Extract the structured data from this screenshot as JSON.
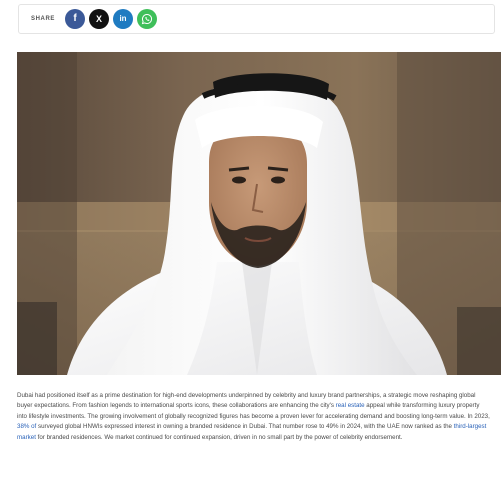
{
  "share": {
    "label": "SHARE",
    "buttons": [
      {
        "name": "facebook",
        "glyph": "f",
        "color": "#3b5998"
      },
      {
        "name": "x",
        "glyph": "X",
        "color": "#111111"
      },
      {
        "name": "linkedin",
        "glyph": "in",
        "color": "#1f7bc1"
      },
      {
        "name": "whatsapp",
        "glyph": "",
        "color": "#3fbf5a"
      }
    ]
  },
  "colors": {
    "link": "#2a62b8",
    "text": "#4a4a4a"
  },
  "article": {
    "p1": "Dubai had positioned itself as a prime destination for high-end developments underpinned by celebrity and luxury brand partnerships, a strategic move reshaping global buyer expectations. From fashion legends to international sports icons, these collaborations are enhancing the city's ",
    "link1": "real estate",
    "p2": " appeal while transforming luxury property into lifestyle investments. The growing involvement of globally recognized figures has become a proven lever for accelerating demand and boosting long-term value. In 2023, ",
    "link2": "38% of",
    "p3": " surveyed global HNWIs expressed interest in owning a branded residence in Dubai. That number rose to 49% in 2024, with the UAE now ranked as the ",
    "link3": "third-largest market",
    "p4": " for branded residences. We market continued for continued expansion, driven in no small part by the power of celebrity endorsement."
  }
}
